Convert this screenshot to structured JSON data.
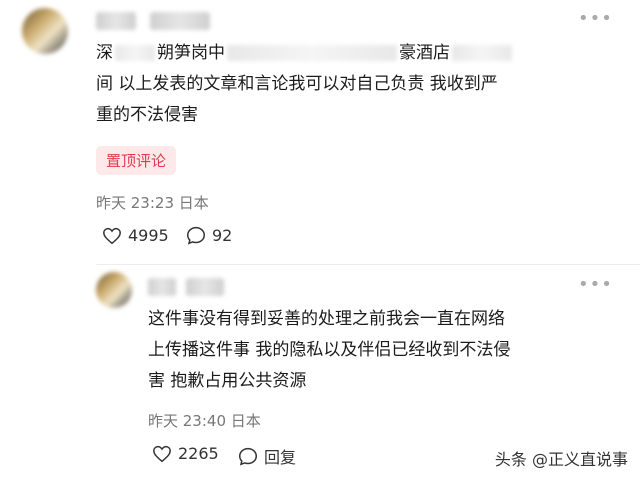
{
  "comment1": {
    "line1_start": "深",
    "line1_a": "朔笋岗中",
    "line1_b": "豪酒店",
    "line2": "间 以上发表的文章和言论我可以对自己负责 我收到严",
    "line3": "重的不法侵害",
    "pinned_label": "置顶评论",
    "time": "昨天 23:23",
    "location": "日本",
    "likes": "4995",
    "replies": "92"
  },
  "comment2": {
    "line1": "这件事没有得到妥善的处理之前我会一直在网络",
    "line2": "上传播这件事 我的隐私以及伴侣已经收到不法侵",
    "line3": "害 抱歉占用公共资源",
    "time": "昨天 23:40",
    "location": "日本",
    "likes": "2265",
    "reply_label": "回复"
  },
  "watermark": "头条 @正义直说事"
}
